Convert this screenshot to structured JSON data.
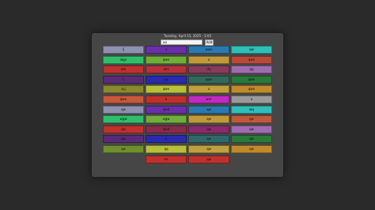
{
  "header": {
    "date": "Tuesday, April 15, 2025 - 3:05",
    "input_value": "oo",
    "add_label": "Add"
  },
  "columns": [
    [
      {
        "label": "ij",
        "color": "#8f8fb0"
      },
      {
        "label": "wgx",
        "color": "#2fbf6a"
      },
      {
        "label": "ww",
        "color": "#c0302c"
      },
      {
        "label": "t",
        "color": "#5a2a78"
      },
      {
        "label": "zyj",
        "color": "#8a8a2c"
      },
      {
        "label": "qwe",
        "color": "#c8583a"
      },
      {
        "label": "qw",
        "color": "#8f8fb0"
      },
      {
        "label": "wgw",
        "color": "#2fbf6a"
      },
      {
        "label": "qw",
        "color": "#c0302c"
      },
      {
        "label": "qw",
        "color": "#5a2a78"
      },
      {
        "label": "qw",
        "color": "#6f8f2c"
      }
    ],
    [
      {
        "label": "a",
        "color": "#6a2fa8"
      },
      {
        "label": "qwe",
        "color": "#6fae3a"
      },
      {
        "label": "wrt",
        "color": "#b8303a"
      },
      {
        "label": "yu",
        "color": "#2a2aae"
      },
      {
        "label": "qwe",
        "color": "#b8c03a"
      },
      {
        "label": "a",
        "color": "#c0302c"
      },
      {
        "label": "qwd",
        "color": "#6a2fa8"
      },
      {
        "label": "wgw",
        "color": "#6fae3a"
      },
      {
        "label": "qwd",
        "color": "#8a2a4a"
      },
      {
        "label": "a",
        "color": "#2a2aae"
      },
      {
        "label": "qq",
        "color": "#b8c03a"
      },
      {
        "label": "ee",
        "color": "#c0302c"
      }
    ],
    [
      {
        "label": "wwe",
        "color": "#2a7ab0"
      },
      {
        "label": "a",
        "color": "#c09a3a"
      },
      {
        "label": "rty",
        "color": "#8a3a5a"
      },
      {
        "label": "qwe",
        "color": "#2f6a5a"
      },
      {
        "label": "a",
        "color": "#c0a03a"
      },
      {
        "label": "wer",
        "color": "#c02ac0"
      },
      {
        "label": "qw",
        "color": "#2a7ab0"
      },
      {
        "label": "qw",
        "color": "#c09a3a"
      },
      {
        "label": "qw",
        "color": "#8a2a6a"
      },
      {
        "label": "qw",
        "color": "#2f6a6a"
      },
      {
        "label": "qw",
        "color": "#c0a03a"
      },
      {
        "label": "qw",
        "color": "#c0302c"
      }
    ],
    [
      {
        "label": "qw",
        "color": "#2fbfb8"
      },
      {
        "label": "qwe",
        "color": "#b84a3a"
      },
      {
        "label": "qq",
        "color": "#a06ab0"
      },
      {
        "label": "qwe",
        "color": "#2a7a3a"
      },
      {
        "label": "qwe",
        "color": "#c08a2a"
      },
      {
        "label": "a",
        "color": "#9a9a9a"
      },
      {
        "label": "wq",
        "color": "#2fbfb8"
      },
      {
        "label": "qw",
        "color": "#c0583a"
      },
      {
        "label": "qw",
        "color": "#a06ab0"
      },
      {
        "label": "qw",
        "color": "#2a7a3a"
      },
      {
        "label": "qw",
        "color": "#c08a2a"
      }
    ]
  ]
}
